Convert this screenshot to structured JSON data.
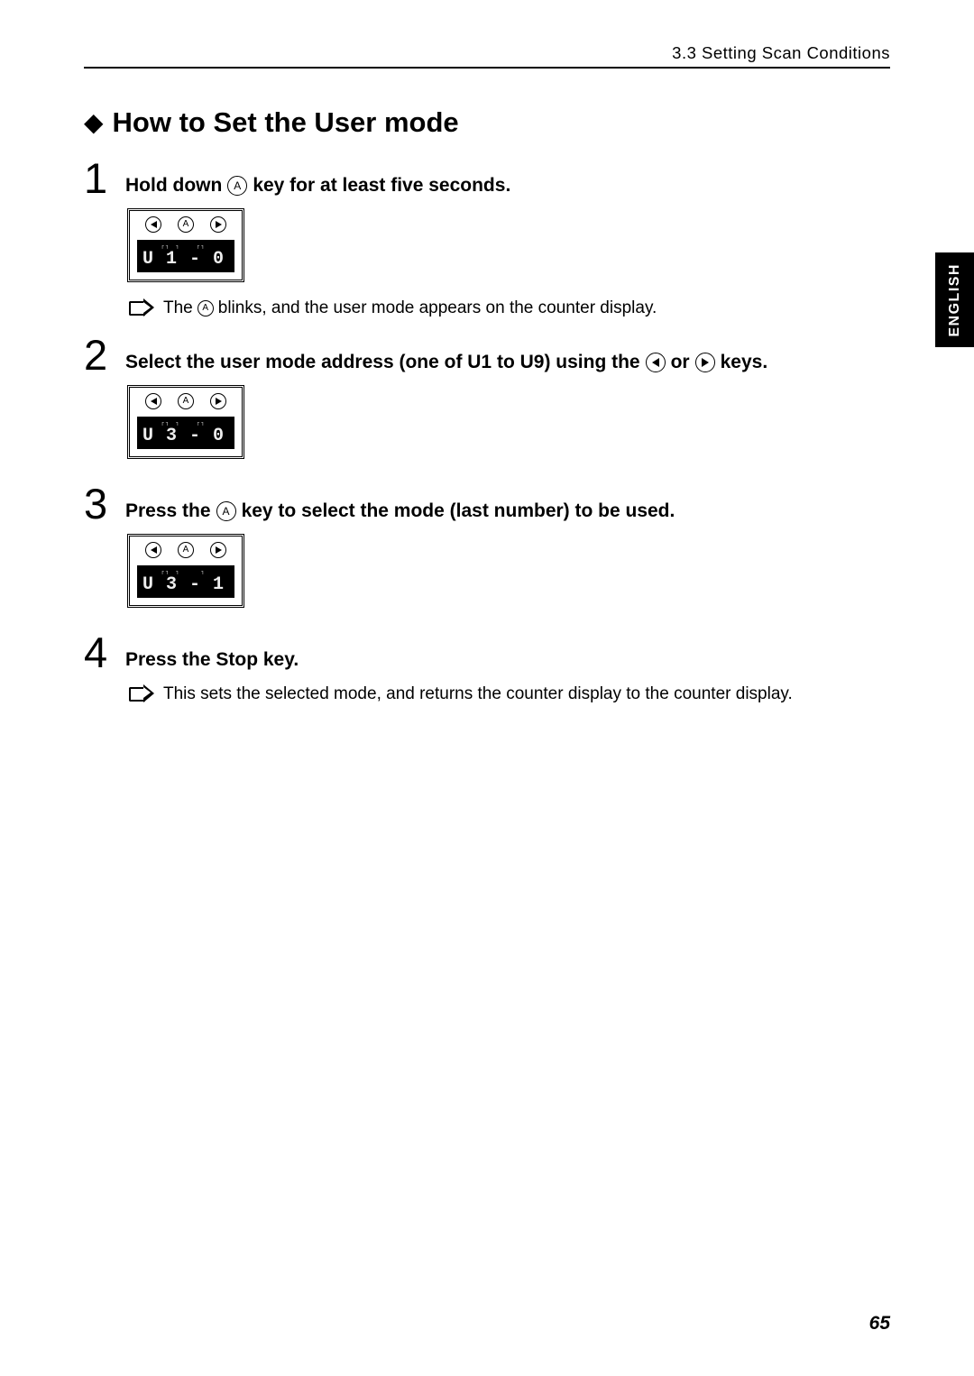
{
  "header": {
    "section": "3.3   Setting Scan Conditions"
  },
  "title": "How to Set the User mode",
  "language_tab": "ENGLISH",
  "page_number": "65",
  "steps": [
    {
      "num": "1",
      "text_before": "Hold down",
      "key": "A",
      "text_after": "key for at least five seconds.",
      "lcd": "U 1 - 0",
      "note_before": "The",
      "note_key": "A",
      "note_after": "blinks, and the user mode appears on the counter display."
    },
    {
      "num": "2",
      "text_before": "Select the user mode address (one of U1 to U9) using the",
      "text_mid": "or",
      "text_after": "keys.",
      "lcd": "U 3 - 0"
    },
    {
      "num": "3",
      "text_before": "Press the",
      "key": "A",
      "text_after": "key to select the mode (last number) to be used.",
      "lcd": "U 3 -  1"
    },
    {
      "num": "4",
      "text": "Press the Stop key.",
      "note": "This sets the selected mode, and returns the counter display to the counter display."
    }
  ]
}
